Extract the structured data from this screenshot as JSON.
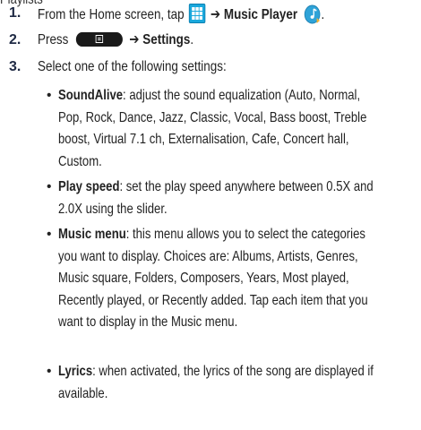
{
  "top_partial": "Playlists",
  "steps": [
    {
      "num": "1.",
      "prefix": "From the Home screen, tap ",
      "arrow": "➔",
      "target": "Music Player",
      "suffix": "."
    },
    {
      "num": "2.",
      "prefix": "Press ",
      "arrow": "➔",
      "target": "Settings",
      "suffix": "."
    },
    {
      "num": "3.",
      "text": "Select one of the following settings:"
    }
  ],
  "settings": [
    {
      "term": "SoundAlive",
      "lines": [
        ": adjust the sound equalization (Auto, Normal,",
        "Pop, Rock, Dance, Jazz, Classic, Vocal, Bass boost, Treble",
        "boost, Virtual 7.1 ch, Externalisation, Cafe, Concert hall,",
        "Custom."
      ]
    },
    {
      "term": "Play speed",
      "lines": [
        ": set the play speed anywhere between 0.5X and",
        "2.0X using the slider."
      ]
    },
    {
      "term": "Music menu",
      "lines": [
        ": this menu allows you to select the categories",
        "you want to display. Choices are: Albums, Artists, Genres,",
        "Music square, Folders, Composers, Years, Most played,",
        "Recently played, or Recently added. Tap each item that you",
        "want to display in the Music menu."
      ]
    },
    {
      "term": "Lyrics",
      "lines": [
        ": when activated, the lyrics of the song are displayed if",
        "available."
      ]
    }
  ],
  "icons": {
    "apps": "apps-grid-icon",
    "music": "music-player-icon",
    "menu": "menu-key-icon"
  },
  "colors": {
    "apps_icon": "#1aa8dc",
    "music_icon": "#2fa3d8",
    "menu_key": "#1a1a1a"
  }
}
